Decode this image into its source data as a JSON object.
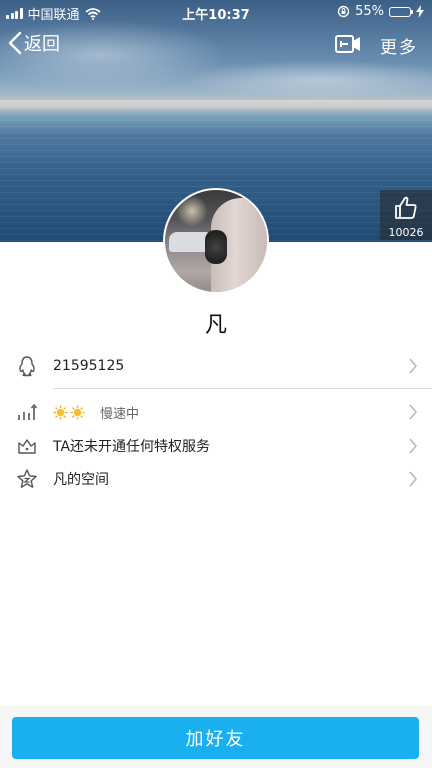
{
  "status_bar": {
    "carrier": "中国联通",
    "time": "上午10:37",
    "battery_text": "55%",
    "battery_level": 0.55,
    "battery_color": "#f5c518"
  },
  "nav": {
    "back_label": "返回",
    "more_label": "更多",
    "video_icon": "video-call-icon"
  },
  "likes": {
    "icon": "thumbs-up-icon",
    "count": "10026"
  },
  "profile": {
    "name": "凡"
  },
  "rows": {
    "qq_number": {
      "icon": "penguin-icon",
      "text": "21595125"
    },
    "level": {
      "icon": "level-chart-icon",
      "badges": [
        "sun-icon",
        "sun-icon"
      ],
      "speed_text": "慢速中"
    },
    "privilege": {
      "icon": "crown-icon",
      "text": "TA还未开通任何特权服务"
    },
    "space": {
      "icon": "star-icon",
      "text": "凡的空间"
    }
  },
  "bottom": {
    "add_friend_label": "加好友",
    "button_color": "#1ab0ef"
  }
}
